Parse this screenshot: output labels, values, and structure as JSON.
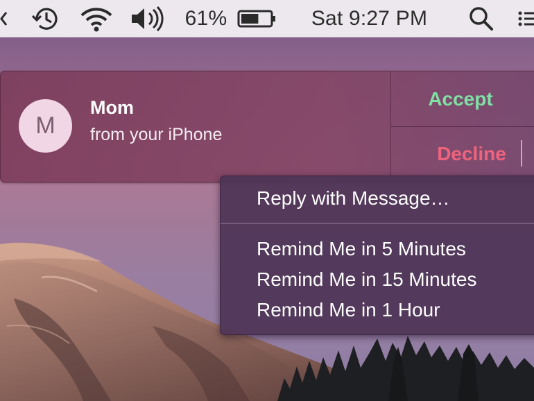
{
  "menubar": {
    "battery_percent": "61%",
    "battery_level": 0.61,
    "clock": "Sat 9:27 PM",
    "icons": [
      "back-icon",
      "time-machine-icon",
      "wifi-icon",
      "volume-icon",
      "battery-icon",
      "spotlight-search-icon",
      "notification-center-icon"
    ]
  },
  "notification": {
    "avatar_initial": "M",
    "caller_name": "Mom",
    "caller_subtitle": "from your iPhone",
    "accept_label": "Accept",
    "decline_label": "Decline",
    "accept_color": "#7fe0a3",
    "decline_color": "#f0637c"
  },
  "menu": {
    "reply_label": "Reply with Message…",
    "remind_items": [
      {
        "label": "Remind Me in 5 Minutes"
      },
      {
        "label": "Remind Me in 15 Minutes"
      },
      {
        "label": "Remind Me in 1 Hour"
      }
    ]
  }
}
